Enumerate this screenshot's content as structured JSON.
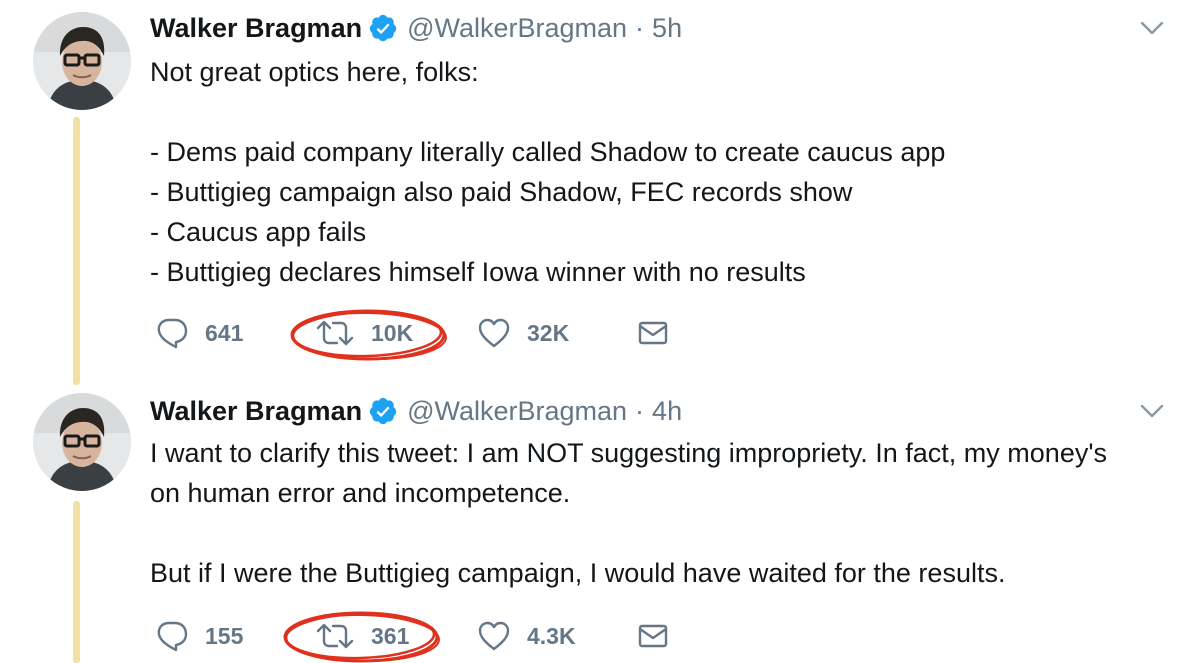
{
  "tweets": [
    {
      "author_name": "Walker Bragman",
      "handle": "@WalkerBragman",
      "separator": "·",
      "time": "5h",
      "lines": [
        "Not great optics here, folks:",
        "",
        "- Dems paid company literally called Shadow to create caucus app",
        "- Buttigieg campaign also paid Shadow, FEC records show",
        "- Caucus app fails",
        "- Buttigieg declares himself Iowa winner with no results"
      ],
      "replies": "641",
      "retweets": "10K",
      "likes": "32K"
    },
    {
      "author_name": "Walker Bragman",
      "handle": "@WalkerBragman",
      "separator": "·",
      "time": "4h",
      "lines": [
        "I want to clarify this tweet: I am NOT suggesting impropriety. In fact, my money's",
        "on human error and incompetence.",
        "",
        "But if I were the Buttigieg campaign, I would have waited for the results."
      ],
      "replies": "155",
      "retweets": "361",
      "likes": "4.3K"
    }
  ],
  "icons": {
    "verified": "verified-badge-icon",
    "reply": "reply-icon",
    "retweet": "retweet-icon",
    "like": "heart-icon",
    "dm": "envelope-icon",
    "menu": "chevron-down-icon"
  },
  "colors": {
    "verified_blue": "#1da1f2",
    "muted_gray": "#657786",
    "thread_line": "#f3e1a3",
    "annotation_red": "#e0301e"
  }
}
